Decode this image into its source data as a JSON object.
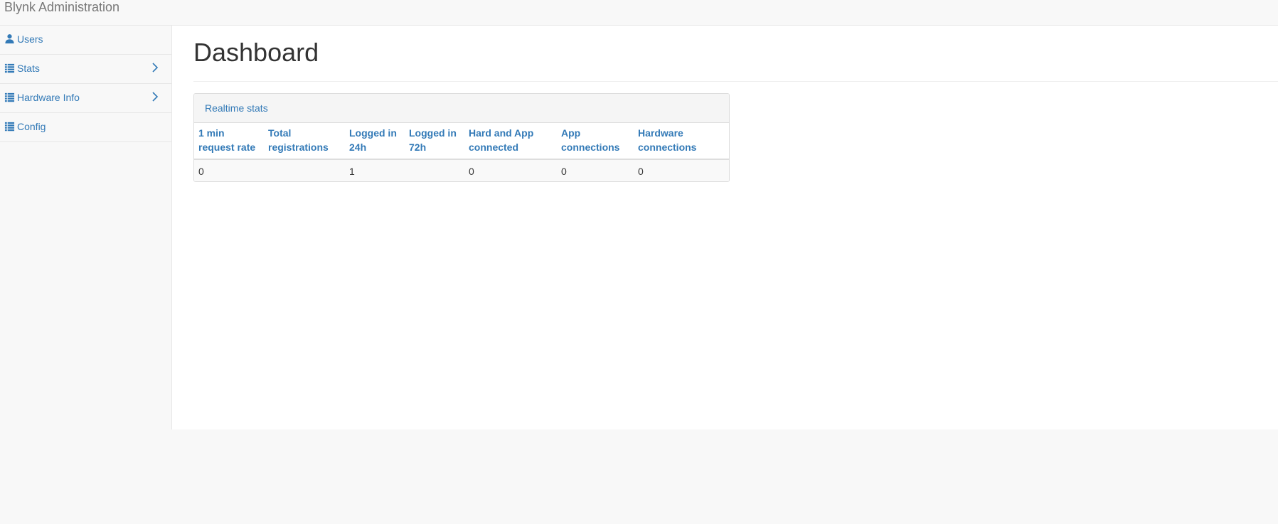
{
  "navbar": {
    "brand": "Blynk Administration"
  },
  "sidebar": {
    "items": [
      {
        "label": "Users",
        "icon": "user-icon",
        "expandable": false
      },
      {
        "label": "Stats",
        "icon": "list-icon",
        "expandable": true
      },
      {
        "label": "Hardware Info",
        "icon": "list-icon",
        "expandable": true
      },
      {
        "label": "Config",
        "icon": "list-icon",
        "expandable": false
      }
    ]
  },
  "main": {
    "title": "Dashboard",
    "panel": {
      "heading": "Realtime stats",
      "columns": [
        "1 min request rate",
        "Total registrations",
        "Logged in 24h",
        "Logged in 72h",
        "Hard and App connected",
        "App connections",
        "Hardware connections"
      ],
      "row": [
        "0",
        "",
        "1",
        "",
        "0",
        "0",
        "0"
      ]
    }
  },
  "colors": {
    "link": "#337ab7",
    "sidebar_bg": "#f8f8f8",
    "content_bg": "#ffffff"
  }
}
